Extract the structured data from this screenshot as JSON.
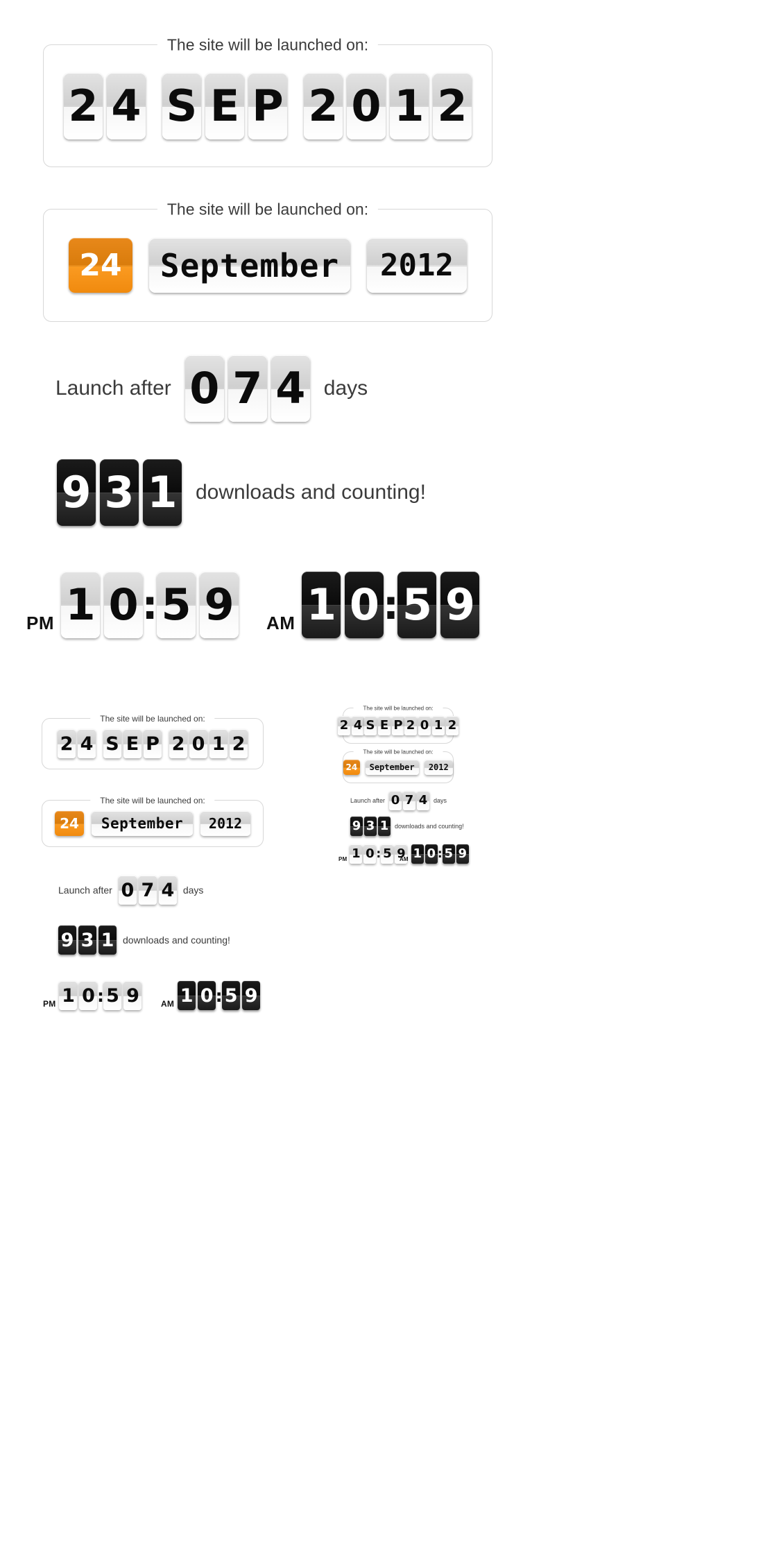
{
  "widgets": {
    "date_abbrev": {
      "title": "The site will be launched on:",
      "day_digits": [
        "2",
        "4"
      ],
      "month_letters": [
        "S",
        "E",
        "P"
      ],
      "year_digits": [
        "2",
        "0",
        "1",
        "2"
      ]
    },
    "date_full": {
      "title": "The site will be launched on:",
      "day": "24",
      "month": "September",
      "year": "2012"
    },
    "launch_after": {
      "prefix_label": "Launch after",
      "digits": [
        "0",
        "7",
        "4"
      ],
      "suffix_label": "days"
    },
    "downloads": {
      "digits": [
        "9",
        "3",
        "1"
      ],
      "suffix_label": "downloads and counting!"
    },
    "clock_light": {
      "meridiem": "PM",
      "hour_digits": [
        "1",
        "0"
      ],
      "separator": ":",
      "minute_digits": [
        "5",
        "9"
      ]
    },
    "clock_dark": {
      "meridiem": "AM",
      "hour_digits": [
        "1",
        "0"
      ],
      "separator": ":",
      "minute_digits": [
        "5",
        "9"
      ]
    }
  },
  "colors": {
    "accent_orange": "#f08a0e",
    "card_light_top": "#cfcfcf",
    "card_light_bottom": "#ffffff",
    "card_dark_top": "#0b0b0b",
    "card_dark_bottom": "#343434",
    "text_dark": "#3b3b3b",
    "panel_border": "#d7d7d7"
  }
}
